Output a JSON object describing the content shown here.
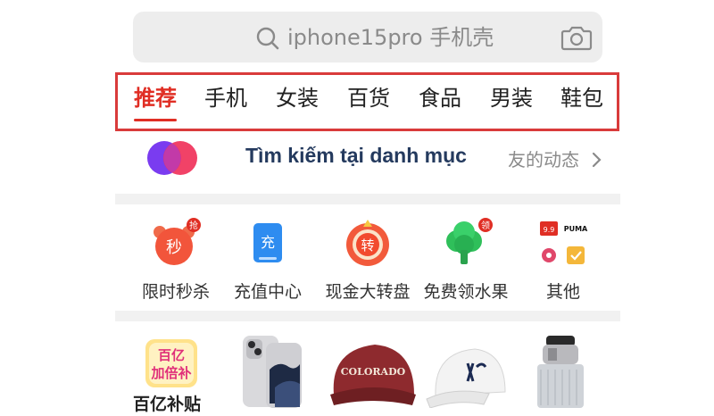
{
  "search": {
    "placeholder": "iphone15pro 手机壳"
  },
  "tabs": [
    {
      "label": "推荐",
      "active": true
    },
    {
      "label": "手机"
    },
    {
      "label": "女装"
    },
    {
      "label": "百货"
    },
    {
      "label": "食品"
    },
    {
      "label": "男装"
    },
    {
      "label": "鞋包"
    }
  ],
  "banner": {
    "text": "Tìm kiếm tại danh mục",
    "friend_activity": "友的动态"
  },
  "functions": [
    {
      "label": "限时秒杀",
      "icon": "flash-sale-clock-icon",
      "badge": "抢",
      "glyph": "秒"
    },
    {
      "label": "充值中心",
      "icon": "recharge-icon",
      "glyph": "充"
    },
    {
      "label": "现金大转盘",
      "icon": "cash-wheel-icon",
      "glyph": "转"
    },
    {
      "label": "免费领水果",
      "icon": "free-fruit-tree-icon",
      "badge": "领"
    },
    {
      "label": "其他",
      "icon": "more-brands-icon",
      "mini_text": [
        "9.9",
        "PUMA"
      ]
    }
  ],
  "products": {
    "subsidy_badge": [
      "百亿",
      "加倍补"
    ],
    "subsidy_label": "百亿补贴",
    "cap_text": "COLORADO"
  },
  "colors": {
    "accent": "#e02e24",
    "highlight_box": "#d93b3b",
    "banner_text": "#243a5e"
  }
}
